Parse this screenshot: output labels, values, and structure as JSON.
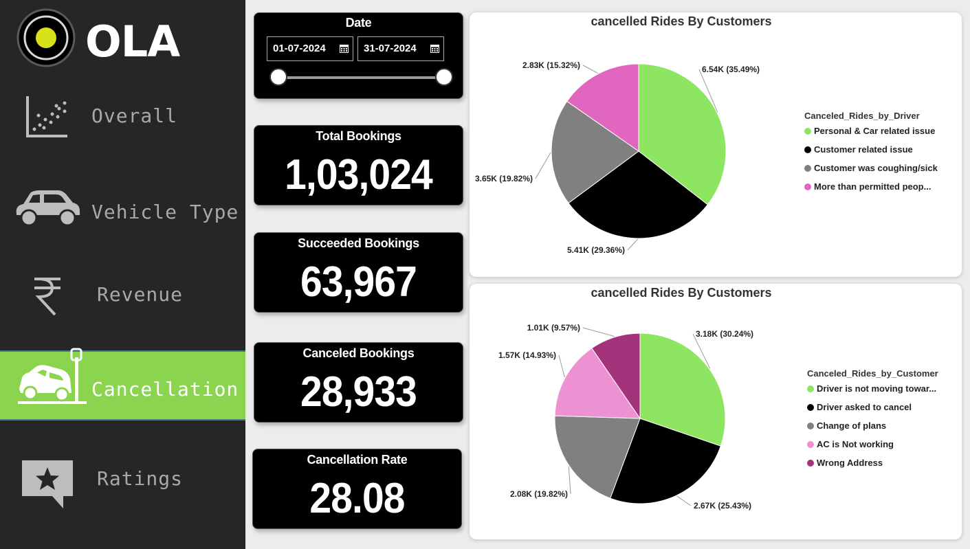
{
  "brand": {
    "name": "OLA"
  },
  "nav": [
    {
      "label": "Overall",
      "icon": "scatter-chart-icon",
      "active": false
    },
    {
      "label": "Vehicle Type",
      "icon": "car-icon",
      "active": false
    },
    {
      "label": "Revenue",
      "icon": "rupee-icon",
      "active": false
    },
    {
      "label": "Cancellation",
      "icon": "car-crash-icon",
      "active": true
    },
    {
      "label": "Ratings",
      "icon": "star-chat-icon",
      "active": false
    }
  ],
  "date_filter": {
    "title": "Date",
    "start": "01-07-2024",
    "end": "31-07-2024"
  },
  "kpis": {
    "total": {
      "title": "Total Bookings",
      "value": "1,03,024"
    },
    "succeeded": {
      "title": "Succeeded Bookings",
      "value": "63,967"
    },
    "canceled": {
      "title": "Canceled Bookings",
      "value": "28,933"
    },
    "rate": {
      "title": "Cancellation Rate",
      "value": "28.08"
    }
  },
  "colors": {
    "accent": "#8bd44f",
    "sidebar": "#262626"
  },
  "chart_data": [
    {
      "type": "pie",
      "title": "cancelled Rides By Customers",
      "legend_title": "Canceled_Rides_by_Driver",
      "legend_position": "right",
      "slices": [
        {
          "name": "Personal & Car related issue",
          "value": 6.54,
          "label": "6.54K (35.49%)",
          "percent": 35.49,
          "color": "#8ee562"
        },
        {
          "name": "Customer related issue",
          "value": 5.41,
          "label": "5.41K (29.36%)",
          "percent": 29.36,
          "color": "#000000"
        },
        {
          "name": "Customer was coughing/sick",
          "value": 3.65,
          "label": "3.65K (19.82%)",
          "percent": 19.82,
          "color": "#808080"
        },
        {
          "name": "More than permitted peop...",
          "value": 2.83,
          "label": "2.83K (15.32%)",
          "percent": 15.32,
          "color": "#e066bf"
        }
      ]
    },
    {
      "type": "pie",
      "title": "cancelled Rides By Customers",
      "legend_title": "Canceled_Rides_by_Customer",
      "legend_position": "right",
      "slices": [
        {
          "name": "Driver is not moving towar...",
          "value": 3.18,
          "label": "3.18K (30.24%)",
          "percent": 30.24,
          "color": "#8ee562"
        },
        {
          "name": "Driver asked to cancel",
          "value": 2.67,
          "label": "2.67K (25.43%)",
          "percent": 25.43,
          "color": "#000000"
        },
        {
          "name": "Change of plans",
          "value": 2.08,
          "label": "2.08K (19.82%)",
          "percent": 19.82,
          "color": "#808080"
        },
        {
          "name": "AC is Not working",
          "value": 1.57,
          "label": "1.57K (14.93%)",
          "percent": 14.93,
          "color": "#ec92d2"
        },
        {
          "name": "Wrong Address",
          "value": 1.01,
          "label": "1.01K (9.57%)",
          "percent": 9.57,
          "color": "#a3337a"
        }
      ]
    }
  ]
}
